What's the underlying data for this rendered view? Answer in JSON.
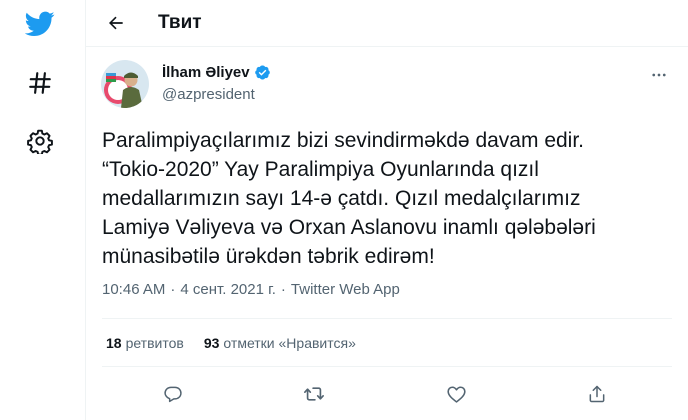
{
  "header": {
    "title": "Твит"
  },
  "nav": {
    "icons": [
      "twitter-bird-icon",
      "hashtag-icon",
      "settings-gear-icon"
    ]
  },
  "tweet": {
    "author": {
      "name": "İlham Əliyev",
      "handle": "@azpresident",
      "verified": true
    },
    "text": "Paralimpiyaçılarımız bizi sevindirməkdə davam edir.\n“Tokio-2020” Yay Paralimpiya Oyunlarında qızıl\nmedallarımızın sayı 14-ə çatdı. Qızıl medalçılarımız\nLamiyə Vəliyeva və Orxan Aslanovu inamlı qələbələri\nmünasibətilə ürəkdən təbrik edirəm!",
    "time": "10:46 AM",
    "date": "4 сент. 2021 г.",
    "separator": "·",
    "source": "Twitter Web App"
  },
  "stats": {
    "retweets_count": "18",
    "retweets_label": "ретвитов",
    "likes_count": "93",
    "likes_label": "отметки «Нравится»"
  },
  "colors": {
    "brand": "#1d9bf0",
    "text_primary": "#0f1419",
    "text_secondary": "#536471",
    "border": "#eff3f4"
  }
}
